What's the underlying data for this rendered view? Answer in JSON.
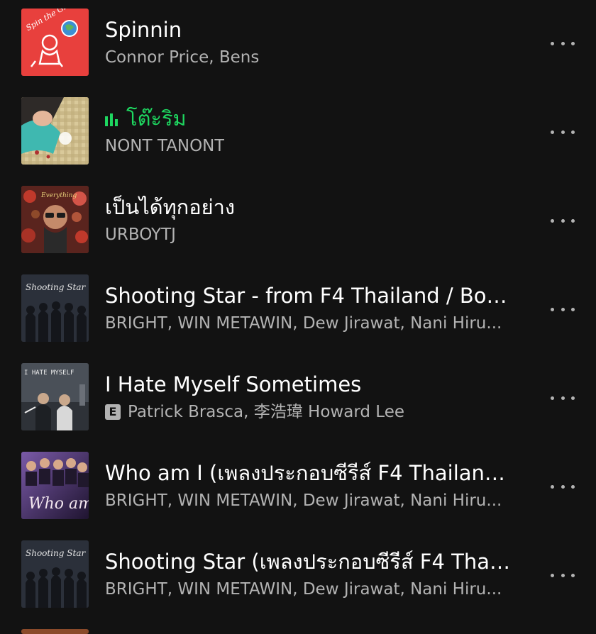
{
  "tracks": [
    {
      "title": "Spinnin",
      "subtitle": "Connor Price, Bens",
      "explicit": false,
      "playing": false,
      "art": {
        "bg": "#e8403d",
        "accent": "#ffffff",
        "label": "Spin the Globe!"
      }
    },
    {
      "title": "โต๊ะริม",
      "subtitle": "NONT TANONT",
      "explicit": false,
      "playing": true,
      "art": {
        "bg": "#c7b58a",
        "accent": "#3fb8b0",
        "label": ""
      }
    },
    {
      "title": "เป็นได้ทุกอย่าง",
      "subtitle": "URBOYTJ",
      "explicit": false,
      "playing": false,
      "art": {
        "bg": "#6b2a22",
        "accent": "#c0a040",
        "label": "Everything"
      }
    },
    {
      "title": "Shooting Star - from F4 Thailand / Boys...",
      "subtitle": "BRIGHT, WIN METAWIN, Dew Jirawat, Nani Hiru...",
      "explicit": false,
      "playing": false,
      "art": {
        "bg": "#2a2f3a",
        "accent": "#d9d9d9",
        "label": "Shooting Star"
      }
    },
    {
      "title": "I Hate Myself Sometimes",
      "subtitle": "Patrick Brasca, 李浩瑋 Howard Lee",
      "explicit": true,
      "explicit_label": "E",
      "playing": false,
      "art": {
        "bg": "#3a3f46",
        "accent": "#e6e6e6",
        "label": "I HATE MYSELF SOMETIMES"
      }
    },
    {
      "title": "Who am I (เพลงประกอบซีรีส์ F4 Thailand :...",
      "subtitle": "BRIGHT, WIN METAWIN, Dew Jirawat, Nani Hiru...",
      "explicit": false,
      "playing": false,
      "art": {
        "bg": "#3b2a55",
        "accent": "#e8c0d0",
        "label": "Who am I"
      }
    },
    {
      "title": "Shooting Star (เพลงประกอบซีรีส์ F4 Thail...",
      "subtitle": "BRIGHT, WIN METAWIN, Dew Jirawat, Nani Hiru...",
      "explicit": false,
      "playing": false,
      "art": {
        "bg": "#2a2f3a",
        "accent": "#d9d9d9",
        "label": "Shooting Star"
      }
    }
  ],
  "colors": {
    "background": "#121212",
    "primary_text": "#ffffff",
    "secondary_text": "#b3b3b3",
    "accent": "#1ed760"
  },
  "icons": {
    "more": "more-options-icon",
    "playing": "equalizer-icon",
    "explicit": "explicit-badge"
  }
}
